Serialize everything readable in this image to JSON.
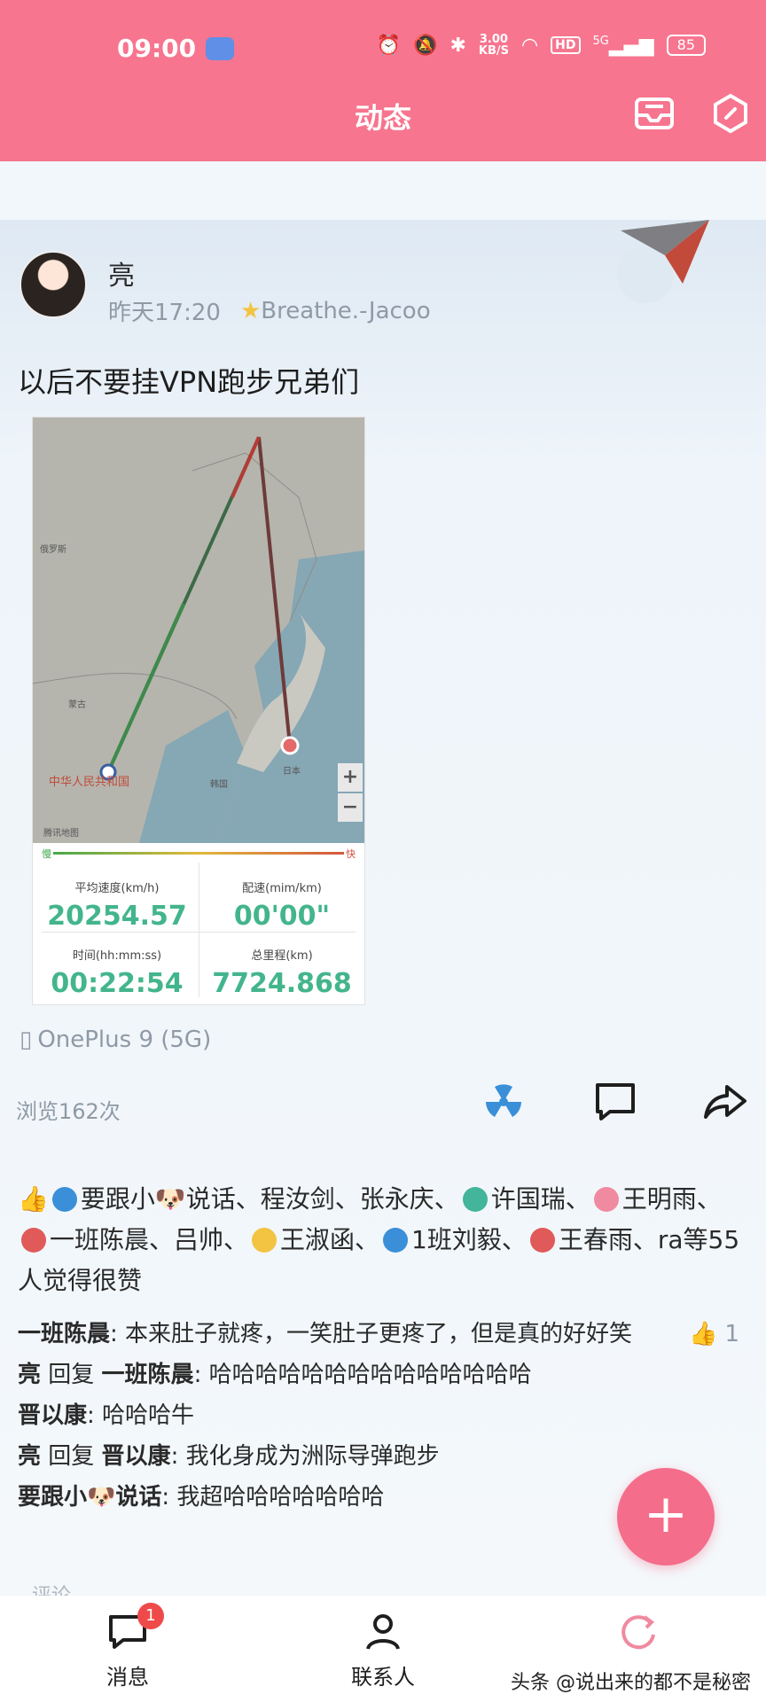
{
  "status_bar": {
    "time": "09:00",
    "network_speed": "3.00",
    "speed_unit": "KB/S",
    "hd": "HD",
    "signal": "5G",
    "battery": "85"
  },
  "header": {
    "title": "动态"
  },
  "post": {
    "author": "亮",
    "time": "昨天17:20",
    "tag": "Breathe.-Jacoo",
    "text": "以后不要挂VPN跑步兄弟们",
    "device": "OnePlus 9 (5G)",
    "views": "浏览162次",
    "screenshot": {
      "legend_slow": "慢",
      "legend_fast": "快",
      "map_labels": {
        "russia": "俄罗斯",
        "mongolia": "蒙古",
        "china": "中华人民共和国",
        "korea": "韩国",
        "japan": "日本",
        "provider": "腾讯地图"
      },
      "stats": [
        {
          "label": "平均速度(km/h)",
          "value": "20254.57"
        },
        {
          "label": "配速(mim/km)",
          "value": "00'00\""
        },
        {
          "label": "时间(hh:mm:ss)",
          "value": "00:22:54"
        },
        {
          "label": "总里程(km)",
          "value": "7724.868"
        }
      ]
    }
  },
  "likes": {
    "p1": "要跟小🐶说话、程汝剑、张永庆、",
    "p2": "许国瑞、",
    "p3": "王明雨、",
    "p4": "一班陈晨、吕帅、",
    "p5": "王淑函、",
    "p6": "1班刘毅、",
    "p7": "王春雨、ra等55人觉得很赞"
  },
  "comments": [
    {
      "name": "一班陈晨",
      "reply_word": "",
      "reply_to": "",
      "text": ": 本来肚子就疼，一笑肚子更疼了，但是真的好好笑",
      "likes": "1"
    },
    {
      "name": "亮",
      "reply_word": " 回复 ",
      "reply_to": "一班陈晨",
      "text": ": 哈哈哈哈哈哈哈哈哈哈哈哈哈哈",
      "likes": ""
    },
    {
      "name": "晋以康",
      "reply_word": "",
      "reply_to": "",
      "text": ": 哈哈哈牛",
      "likes": ""
    },
    {
      "name": "亮",
      "reply_word": " 回复 ",
      "reply_to": "晋以康",
      "text": ": 我化身成为洲际导弹跑步",
      "likes": ""
    },
    {
      "name": "要跟小🐶说话",
      "reply_word": "",
      "reply_to": "",
      "text": ": 我超哈哈哈哈哈哈哈",
      "likes": ""
    }
  ],
  "comment_section_label": "评论",
  "fab_label": "+",
  "bottom_nav": [
    {
      "label": "消息",
      "badge": "1"
    },
    {
      "label": "联系人"
    }
  ],
  "watermark": "头条 @说出来的都不是秘密",
  "colors": {
    "header": "#f7758f",
    "accent_green": "#43b58c",
    "fab": "#f46d8a",
    "badge": "#ef4a4a"
  },
  "icons": [
    "mail-icon",
    "hexagon-settings-icon",
    "radiation-like-icon",
    "comment-icon",
    "share-icon",
    "thumbs-up-icon",
    "phone-icon",
    "message-icon",
    "contacts-icon",
    "refresh-icon"
  ]
}
